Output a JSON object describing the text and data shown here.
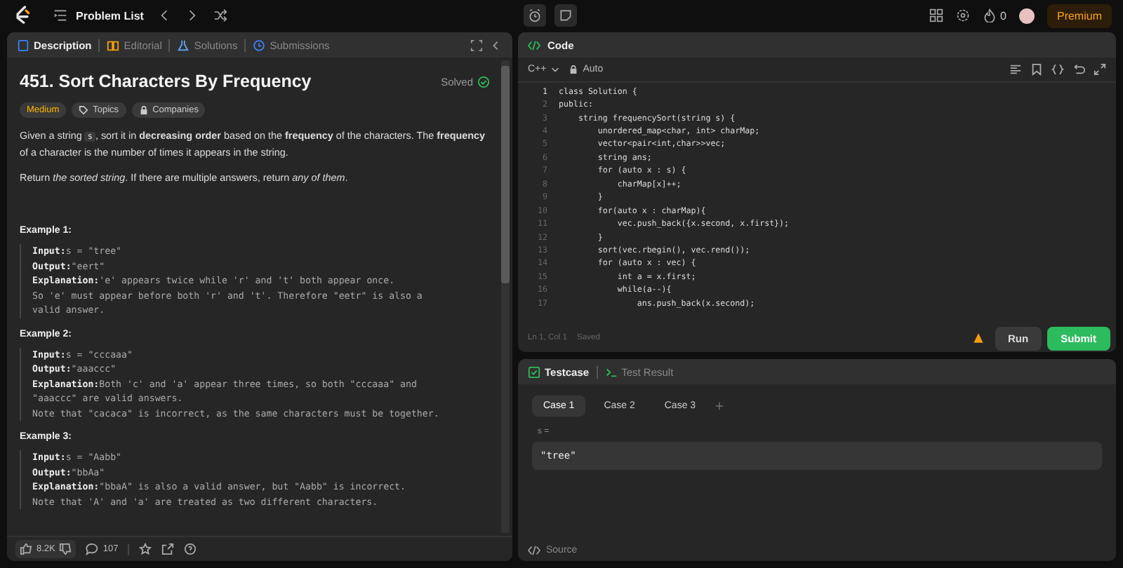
{
  "topbar": {
    "problem_list": "Problem List",
    "streak": "0",
    "premium": "Premium"
  },
  "description_panel": {
    "tabs": [
      {
        "label": "Description",
        "selected": true
      },
      {
        "label": "Editorial",
        "selected": false
      },
      {
        "label": "Solutions",
        "selected": false
      },
      {
        "label": "Submissions",
        "selected": false
      }
    ],
    "title": "451. Sort Characters By Frequency",
    "status": "Solved",
    "tags": [
      {
        "label": "Medium",
        "kind": "difficulty"
      },
      {
        "label": "Topics",
        "kind": "tag"
      },
      {
        "label": "Companies",
        "kind": "lock"
      }
    ],
    "paragraphs": [
      {
        "segments": [
          {
            "kind": "text",
            "text": "Given a string "
          },
          {
            "kind": "code",
            "text": "s"
          },
          {
            "kind": "text",
            "text": ", sort it in **decreasing order** based on the **frequency** of the characters. The **frequency** of a character is the number of times it appears in the string."
          }
        ]
      },
      {
        "segments": [
          {
            "kind": "text",
            "text": "Return *the sorted string*. If there are multiple answers, return *any of them*."
          }
        ]
      }
    ],
    "examples": [
      {
        "title": "Example 1:",
        "lines": [
          {
            "label": "Input:",
            "text": "s = \"tree\""
          },
          {
            "label": "Output:",
            "text": "\"eert\""
          },
          {
            "label": "Explanation:",
            "text": "'e' appears twice while 'r' and 't' both appear once."
          },
          {
            "text": "So 'e' must appear before both 'r' and 't'. Therefore \"eetr\" is also a"
          },
          {
            "text": "valid answer."
          }
        ]
      },
      {
        "title": "Example 2:",
        "lines": [
          {
            "label": "Input:",
            "text": "s = \"cccaaa\""
          },
          {
            "label": "Output:",
            "text": "\"aaaccc\""
          },
          {
            "label": "Explanation:",
            "text": "Both 'c' and 'a' appear three times, so both \"cccaaa\" and"
          },
          {
            "text": "\"aaaccc\" are valid answers."
          },
          {
            "text": "Note that \"cacaca\" is incorrect, as the same characters must be together."
          }
        ]
      },
      {
        "title": "Example 3:",
        "lines": [
          {
            "label": "Input:",
            "text": "s = \"Aabb\""
          },
          {
            "label": "Output:",
            "text": "\"bbAa\""
          },
          {
            "label": "Explanation:",
            "text": "\"bbaA\" is also a valid answer, but \"Aabb\" is incorrect."
          },
          {
            "text": "Note that 'A' and 'a' are treated as two different characters."
          }
        ]
      }
    ],
    "likes": "8.2K",
    "comments": "107"
  },
  "code_panel": {
    "title": "Code",
    "language": "C++",
    "mode": "Auto",
    "lines": [
      {
        "number": "1",
        "text": "class Solution {"
      },
      {
        "number": "2",
        "text": "public:"
      },
      {
        "number": "3",
        "text": "    string frequencySort(string s) {"
      },
      {
        "number": "4",
        "text": "        unordered_map<char, int> charMap;"
      },
      {
        "number": "5",
        "text": "        vector<pair<int,char>>vec;"
      },
      {
        "number": "6",
        "text": "        string ans;"
      },
      {
        "number": "7",
        "text": "        for (auto x : s) {"
      },
      {
        "number": "8",
        "text": "            charMap[x]++;"
      },
      {
        "number": "9",
        "text": "        }"
      },
      {
        "number": "10",
        "text": "        for(auto x : charMap){"
      },
      {
        "number": "11",
        "text": "            vec.push_back({x.second, x.first});"
      },
      {
        "number": "12",
        "text": "        }"
      },
      {
        "number": "13",
        "text": "        sort(vec.rbegin(), vec.rend());"
      },
      {
        "number": "14",
        "text": "        for (auto x : vec) {"
      },
      {
        "number": "15",
        "text": "            int a = x.first;"
      },
      {
        "number": "16",
        "text": "            while(a--){"
      },
      {
        "number": "17",
        "text": "                ans.push_back(x.second);"
      }
    ],
    "position": "Ln 1, Col 1",
    "saved": "Saved",
    "run": "Run",
    "submit": "Submit"
  },
  "test_panel": {
    "tabs": [
      {
        "label": "Testcase",
        "selected": true
      },
      {
        "label": "Test Result",
        "selected": false
      }
    ],
    "cases": [
      {
        "label": "Case 1",
        "selected": true
      },
      {
        "label": "Case 2",
        "selected": false
      },
      {
        "label": "Case 3",
        "selected": false
      }
    ],
    "variable": "s =",
    "value": "\"tree\"",
    "source": "Source"
  }
}
